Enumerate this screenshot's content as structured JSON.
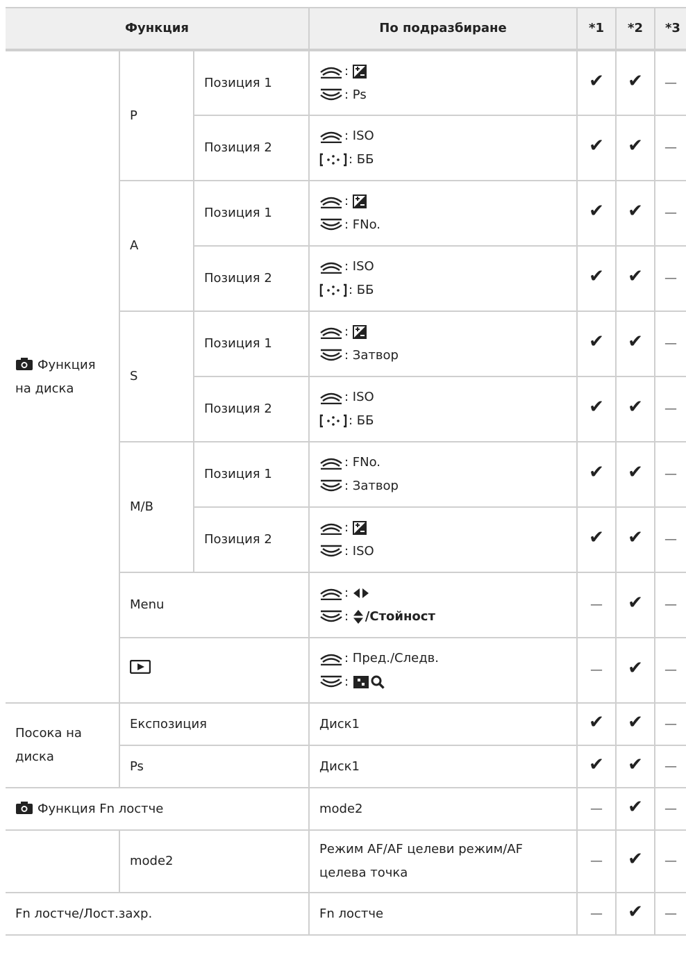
{
  "headers": {
    "function": "Функция",
    "default": "По подразбиране",
    "n1": "*1",
    "n2": "*2",
    "n3": "*3"
  },
  "colors": {
    "border": "#cfcfcf",
    "header_bg": "#efefef"
  },
  "icons": {
    "front_dial": "front-dial-icon",
    "rear_dial": "rear-dial-icon",
    "multi_selector": "multi-selector-icon",
    "exposure_comp": "exposure-compensation-icon",
    "camera": "camera-icon",
    "playback": "playback-icon",
    "left_right": "left-right-arrows-icon",
    "up_down": "up-down-arrows-icon",
    "index": "index-view-icon",
    "magnify": "magnify-icon"
  },
  "dial_group": {
    "label": "Функция на диска",
    "P": {
      "label": "P",
      "pos1": {
        "label": "Позиция 1",
        "line2": ": Ps",
        "c1": "✔",
        "c2": "✔",
        "c3": "—"
      },
      "pos2": {
        "label": "Позиция 2",
        "line1": ": ISO",
        "line2": ": ББ",
        "c1": "✔",
        "c2": "✔",
        "c3": "—"
      }
    },
    "A": {
      "label": "A",
      "pos1": {
        "label": "Позиция 1",
        "line2": ": FNo.",
        "c1": "✔",
        "c2": "✔",
        "c3": "—"
      },
      "pos2": {
        "label": "Позиция 2",
        "line1": ": ISO",
        "line2": ": ББ",
        "c1": "✔",
        "c2": "✔",
        "c3": "—"
      }
    },
    "S": {
      "label": "S",
      "pos1": {
        "label": "Позиция 1",
        "line2": ": Затвор",
        "c1": "✔",
        "c2": "✔",
        "c3": "—"
      },
      "pos2": {
        "label": "Позиция 2",
        "line1": ": ISO",
        "line2": ": ББ",
        "c1": "✔",
        "c2": "✔",
        "c3": "—"
      }
    },
    "MB": {
      "label": "M/B",
      "pos1": {
        "label": "Позиция 1",
        "line1": ": FNo.",
        "line2": ": Затвор",
        "c1": "✔",
        "c2": "✔",
        "c3": "—"
      },
      "pos2": {
        "label": "Позиция 2",
        "line2": ": ISO",
        "c1": "✔",
        "c2": "✔",
        "c3": "—"
      }
    },
    "menu": {
      "label": "Menu",
      "line2_value": "/Стойност",
      "c1": "—",
      "c2": "✔",
      "c3": "—"
    },
    "play": {
      "line1": ": Пред./Следв.",
      "c1": "—",
      "c2": "✔",
      "c3": "—"
    }
  },
  "direction": {
    "label": "Посока на диска",
    "exposure": {
      "label": "Експозиция",
      "value": "Диск1",
      "c1": "✔",
      "c2": "✔",
      "c3": "—"
    },
    "ps": {
      "label": "Ps",
      "value": "Диск1",
      "c1": "✔",
      "c2": "✔",
      "c3": "—"
    }
  },
  "fn_lever": {
    "label": "Функция Fn лостче",
    "value": "mode2",
    "c1": "—",
    "c2": "✔",
    "c3": "—"
  },
  "mode2": {
    "label": "mode2",
    "value": "Режим AF/AF целеви режим/AF целева точка",
    "c1": "—",
    "c2": "✔",
    "c3": "—"
  },
  "fn_lock": {
    "label": "Fn лостче/Лост.захр.",
    "value": "Fn лостче",
    "c1": "—",
    "c2": "✔",
    "c3": "—"
  }
}
